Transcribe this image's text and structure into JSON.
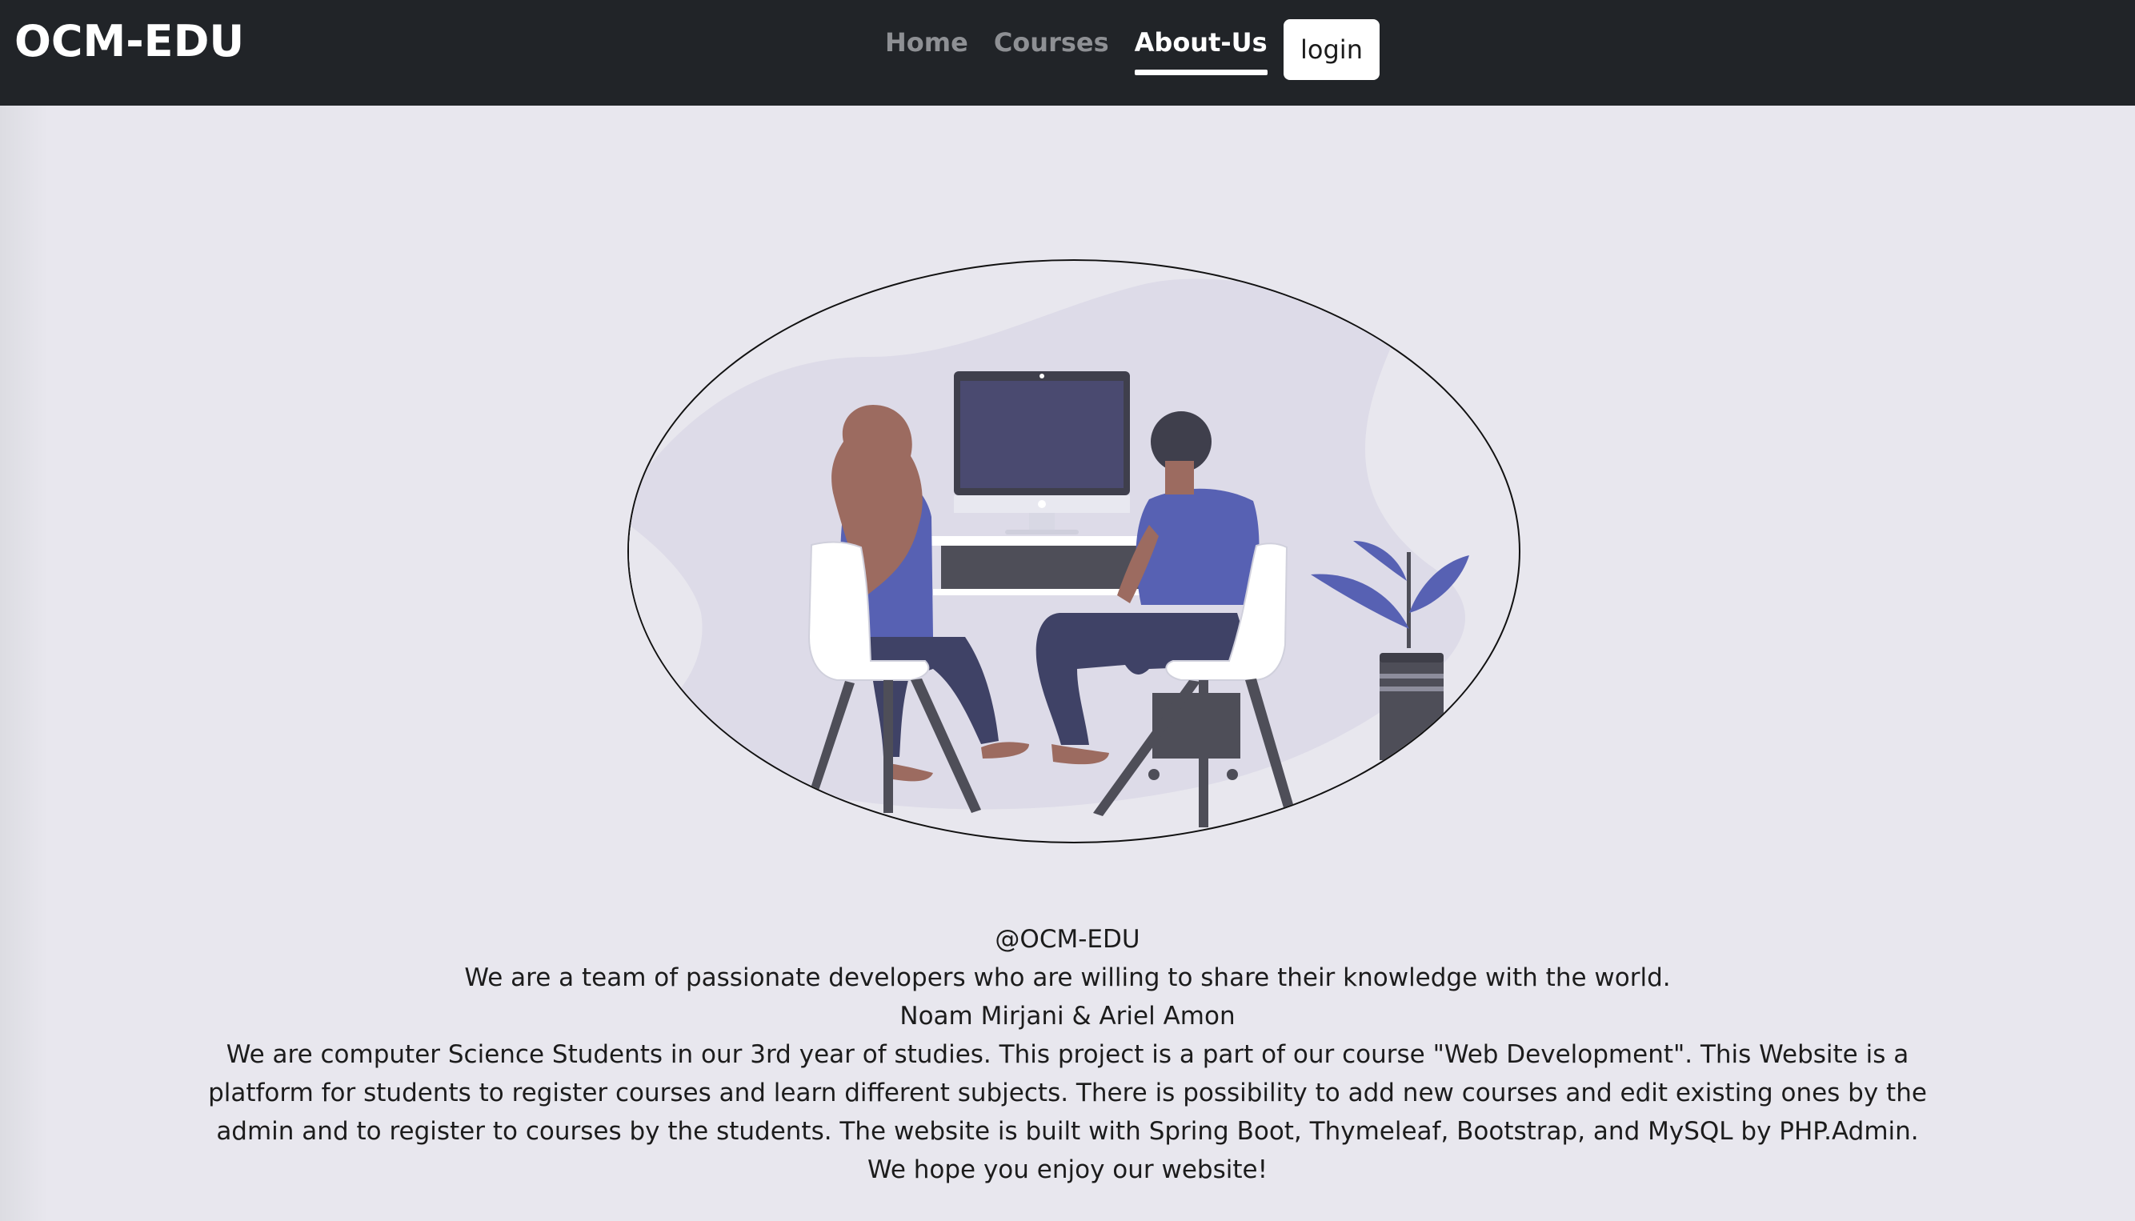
{
  "navbar": {
    "brand": "OCM-EDU",
    "links": [
      {
        "label": "Home",
        "active": false
      },
      {
        "label": "Courses",
        "active": false
      },
      {
        "label": "About-Us",
        "active": true
      }
    ],
    "login_label": "login"
  },
  "about": {
    "handle": "@OCM-EDU",
    "tagline": "We are a team of passionate developers who are willing to share their knowledge with the world.",
    "authors": "Noam Mirjani & Ariel Amon",
    "description": "We are computer Science Students in our 3rd year of studies. This project is a part of our course \"Web Development\". This Website is a platform for students to register courses and learn different subjects. There is possibility to add new courses and edit existing ones by the admin and to register to courses by the students. The website is built with Spring Boot, Thymeleaf, Bootstrap, and MySQL by PHP.Admin.",
    "closing": "We hope you enjoy our website!"
  },
  "colors": {
    "navbar_bg": "#212428",
    "page_bg": "#e8e7ee",
    "accent_purple": "#5761b3",
    "nav_inactive": "#8e9094",
    "nav_active": "#ffffff"
  }
}
